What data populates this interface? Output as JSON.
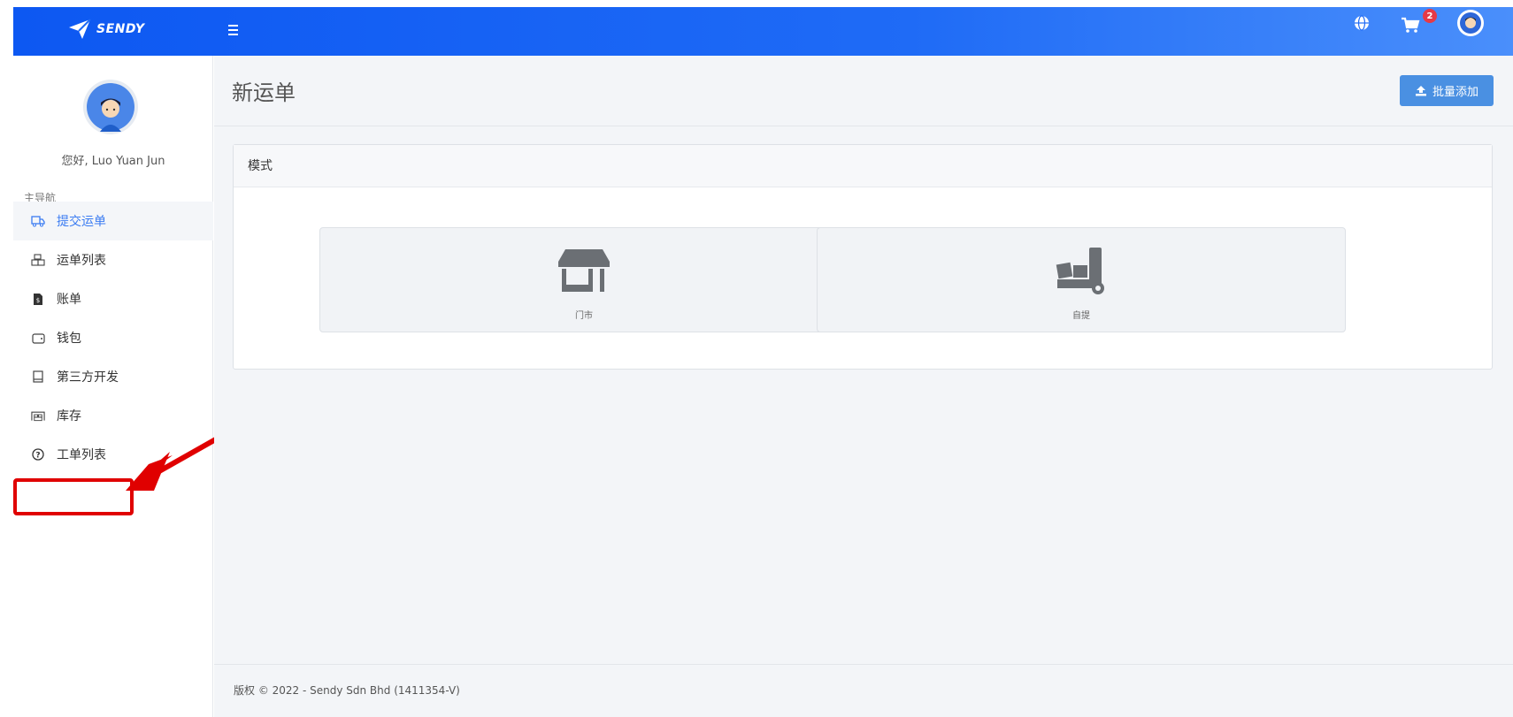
{
  "brand": {
    "name": "SENDY"
  },
  "topbar": {
    "cart_count": "2"
  },
  "sidebar": {
    "greeting": "您好, Luo Yuan Jun",
    "nav_heading": "主导航",
    "items": [
      {
        "label": "提交运单",
        "icon": "truck-icon",
        "active": true
      },
      {
        "label": "运单列表",
        "icon": "packages-icon",
        "active": false
      },
      {
        "label": "账单",
        "icon": "bill-icon",
        "active": false
      },
      {
        "label": "钱包",
        "icon": "wallet-icon",
        "active": false
      },
      {
        "label": "第三方开发",
        "icon": "book-icon",
        "active": false
      },
      {
        "label": "库存",
        "icon": "warehouse-icon",
        "active": false
      },
      {
        "label": "工单列表",
        "icon": "question-circle-icon",
        "active": false
      }
    ]
  },
  "page": {
    "title": "新运单",
    "bulk_add_label": "批量添加"
  },
  "mode_card": {
    "header": "模式",
    "options": [
      {
        "label": "门市",
        "icon": "store-icon"
      },
      {
        "label": "自提",
        "icon": "dolly-icon"
      }
    ]
  },
  "footer": {
    "text": "版权 © 2022 - Sendy Sdn Bhd (1411354-V)"
  },
  "colors": {
    "accent": "#3b7cf2",
    "topbar": "#1f6bf6",
    "highlight": "#e00000",
    "badge": "#e63946"
  }
}
